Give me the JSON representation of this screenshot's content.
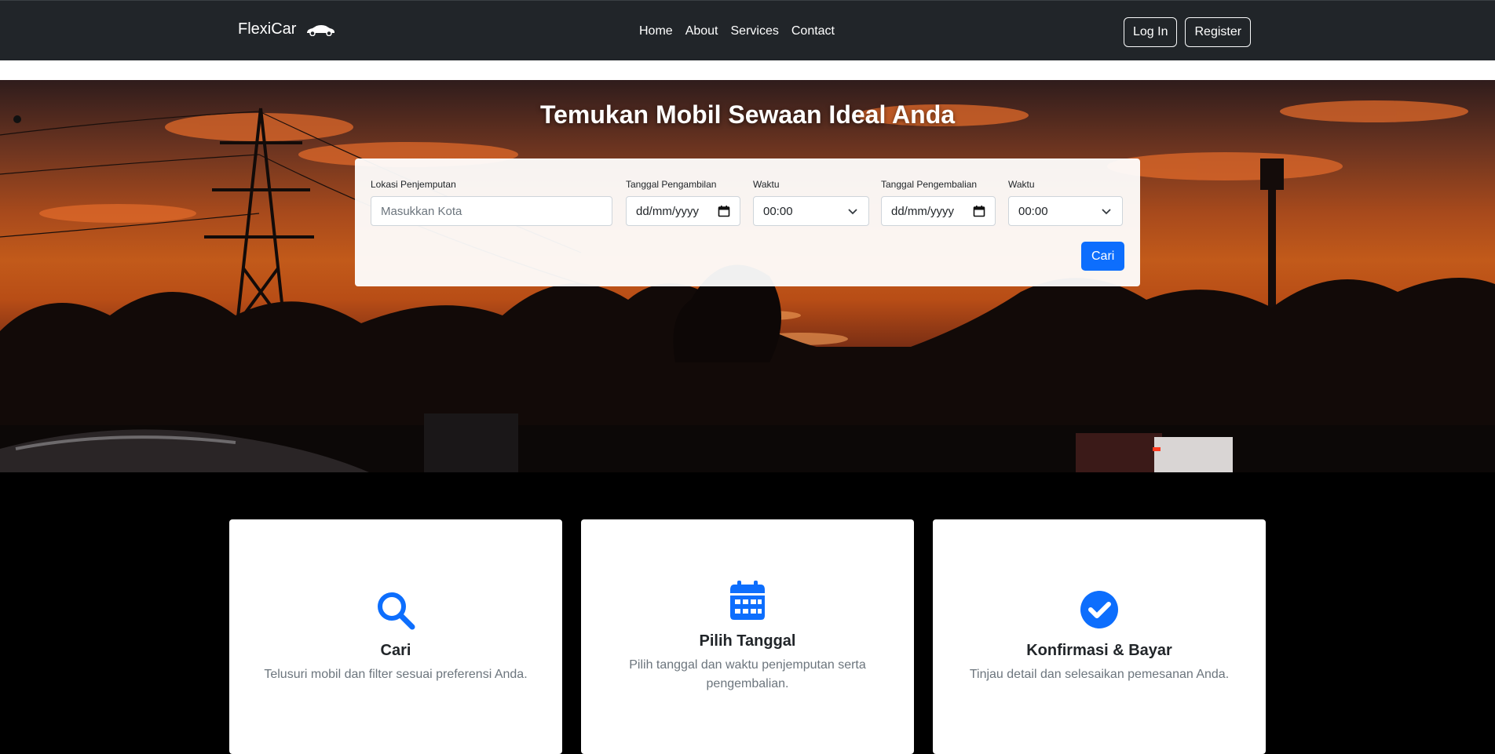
{
  "navbar": {
    "brand": "FlexiCar",
    "links": [
      "Home",
      "About",
      "Services",
      "Contact"
    ],
    "login_label": "Log In",
    "register_label": "Register"
  },
  "hero": {
    "title": "Temukan Mobil Sewaan Ideal Anda"
  },
  "search": {
    "pickup_location_label": "Lokasi Penjemputan",
    "pickup_location_placeholder": "Masukkan Kota",
    "pickup_date_label": "Tanggal Pengambilan",
    "pickup_date_value": "dd/mm/yyyy",
    "pickup_time_label": "Waktu",
    "pickup_time_value": "00:00",
    "return_date_label": "Tanggal Pengembalian",
    "return_date_value": "dd/mm/yyyy",
    "return_time_label": "Waktu",
    "return_time_value": "00:00",
    "submit_label": "Cari"
  },
  "features": [
    {
      "icon": "search-icon",
      "title": "Cari",
      "text": "Telusuri mobil dan filter sesuai preferensi Anda."
    },
    {
      "icon": "calendar-icon",
      "title": "Pilih Tanggal",
      "text": "Pilih tanggal dan waktu penjemputan serta pengembalian."
    },
    {
      "icon": "check-circle-icon",
      "title": "Konfirmasi & Bayar",
      "text": "Tinjau detail dan selesaikan pemesanan Anda."
    }
  ],
  "colors": {
    "navbar_bg": "#212529",
    "primary": "#0d6efd",
    "page_bg": "#000000"
  }
}
